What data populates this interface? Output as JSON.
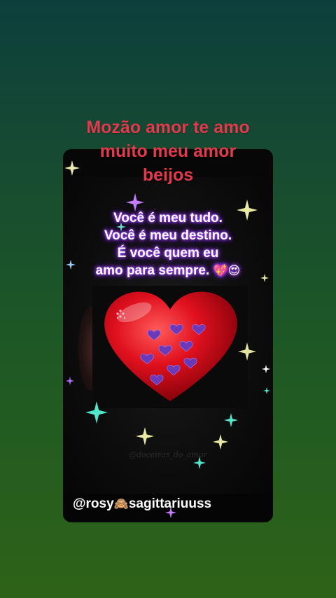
{
  "caption": {
    "line1": "Mozão amor te amo",
    "line2": "muito meu amor",
    "line3": "beijos"
  },
  "poem": {
    "line1": "Você é meu tudo.",
    "line2": "Você é meu destino.",
    "line3": "É você quem eu",
    "line4": "amo para sempre.",
    "emojis": "💖😍"
  },
  "watermark": "@doceiras_do_amor",
  "handle": {
    "prefix": "@rosy",
    "emoji": "🙈",
    "suffix": "sagittariuuss"
  },
  "colors": {
    "caption": "#e23a4c",
    "card_background": "#070707",
    "poem_glow": "#a03cff",
    "heart": "#e0101e"
  },
  "icons": [
    "sparkle-icon",
    "heart-icon",
    "purple-heart-icon",
    "see-no-evil-monkey-icon"
  ]
}
